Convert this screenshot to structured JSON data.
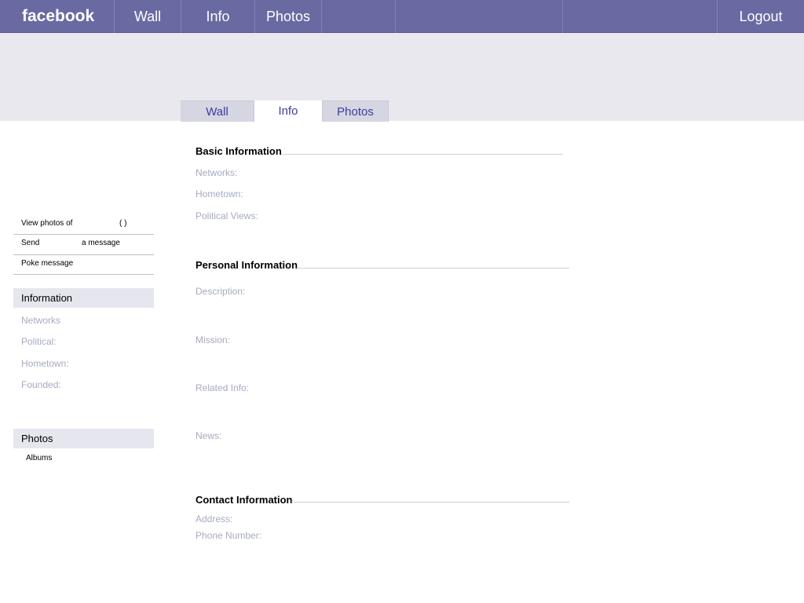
{
  "topbar": {
    "logo": "facebook",
    "nav": [
      "Wall",
      "Info",
      "Photos"
    ],
    "logout": "Logout"
  },
  "profile_tabs": {
    "wall": "Wall",
    "info": "Info",
    "photos": "Photos",
    "active": "Info"
  },
  "sidebar": {
    "actions": {
      "view_photos": "View photos of",
      "view_photos_suffix": "( )",
      "send": "Send",
      "send_suffix": "a message",
      "poke": "Poke message"
    },
    "information": {
      "header": "Information",
      "fields": [
        "Networks",
        "Political:",
        "Hometown:",
        "Founded:"
      ]
    },
    "photos": {
      "header": "Photos",
      "albums": "Albums"
    }
  },
  "main": {
    "basic": {
      "title": "Basic Information",
      "fields": [
        "Networks:",
        "Hometown:",
        "Political Views:"
      ]
    },
    "personal": {
      "title": "Personal Information",
      "fields": [
        "Description:",
        "Mission:",
        "Related Info:",
        "News:"
      ]
    },
    "contact": {
      "title": "Contact Information",
      "fields": [
        "Address:",
        "Phone Number:"
      ]
    }
  },
  "colors": {
    "topbar": "#6a6aa2",
    "banner": "#e8e8ee",
    "tab_inactive": "#d6d6e3",
    "tab_text": "#3b3b9e",
    "label_muted": "#a6abc2"
  }
}
